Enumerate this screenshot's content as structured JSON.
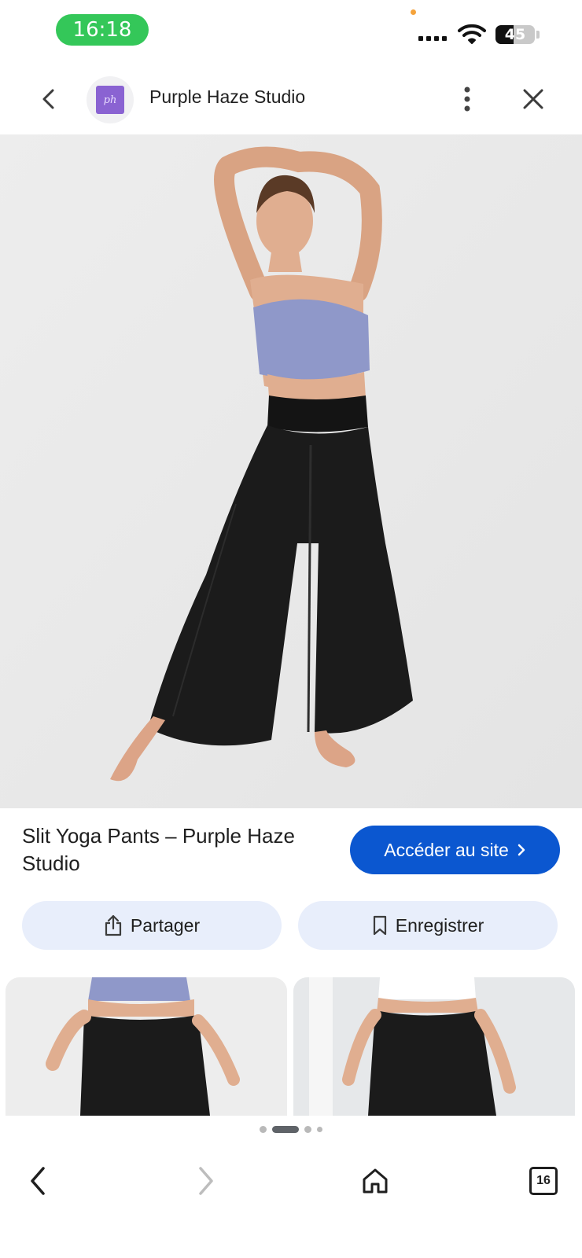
{
  "status_bar": {
    "time": "16:18",
    "battery_level": "45",
    "battery_fraction": 0.45,
    "icons": [
      "signal-dots-icon",
      "wifi-icon",
      "battery-icon"
    ]
  },
  "header": {
    "back_icon": "chevron-left-icon",
    "logo_text": "ph",
    "site_name": "Purple Haze Studio",
    "menu_icon": "more-vertical-icon",
    "close_icon": "close-icon"
  },
  "product": {
    "title": "Slit Yoga Pants – Purple Haze Studio",
    "visit_label": "Accéder au site",
    "share_label": "Partager",
    "save_label": "Enregistrer"
  },
  "carousel": {
    "dot_count": 4,
    "active_index": 1
  },
  "bottom_nav": {
    "tab_count": "16",
    "icons": [
      "back-arrow-icon",
      "forward-arrow-icon",
      "home-icon",
      "tabs-icon"
    ]
  },
  "colors": {
    "accent": "#0b57d0",
    "pill_bg": "#e8eefb",
    "time_pill": "#34c759",
    "logo": "#8a63d2"
  }
}
